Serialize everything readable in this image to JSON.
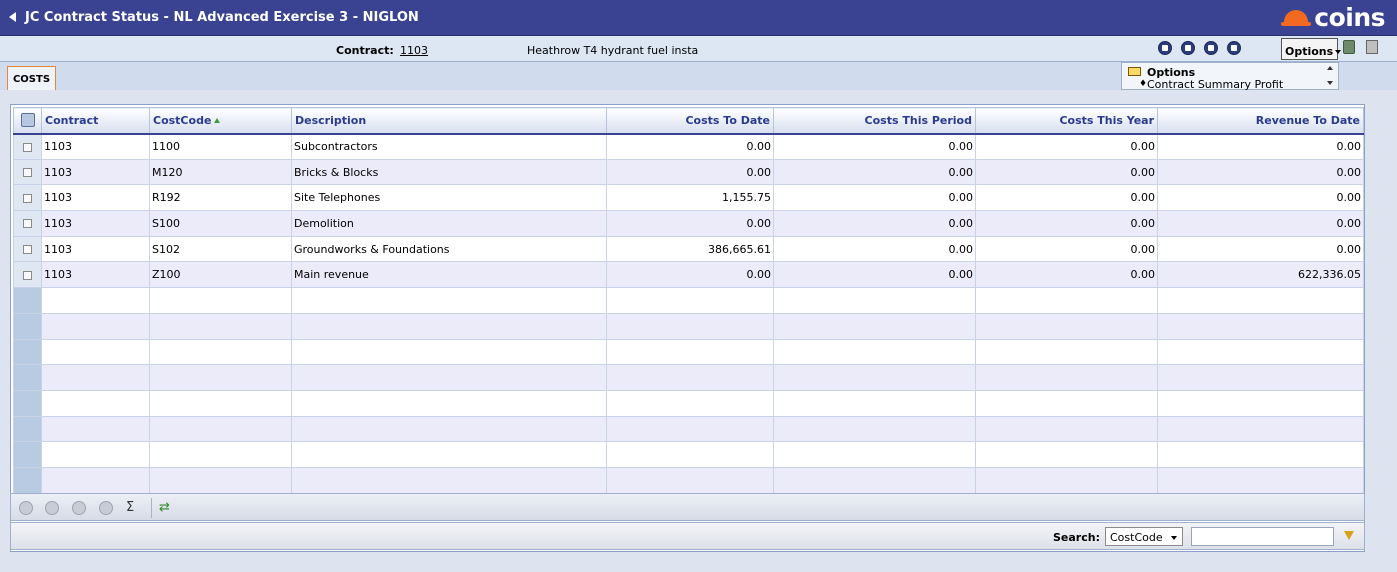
{
  "window": {
    "title": "JC Contract Status - NL Advanced Exercise 3 - NIGLON",
    "logo_text": "coins"
  },
  "header": {
    "contract_label": "Contract:",
    "contract_code": "1103",
    "contract_description": "Heathrow T4 hydrant fuel insta",
    "options_label": "Options"
  },
  "tabs": [
    {
      "label": "COSTS",
      "active": true
    }
  ],
  "options_panel": {
    "title": "Options",
    "item": "Contract Summary Profit"
  },
  "grid": {
    "columns": [
      "Contract",
      "CostCode",
      "Description",
      "Costs To Date",
      "Costs This Period",
      "Costs This Year",
      "Revenue To Date"
    ],
    "sorted_column": "CostCode",
    "rows": [
      {
        "contract": "1103",
        "costcode": "1100",
        "description": "Subcontractors",
        "costs_to_date": "0.00",
        "costs_this_period": "0.00",
        "costs_this_year": "0.00",
        "revenue_to_date": "0.00"
      },
      {
        "contract": "1103",
        "costcode": "M120",
        "description": "Bricks & Blocks",
        "costs_to_date": "0.00",
        "costs_this_period": "0.00",
        "costs_this_year": "0.00",
        "revenue_to_date": "0.00"
      },
      {
        "contract": "1103",
        "costcode": "R192",
        "description": "Site Telephones",
        "costs_to_date": "1,155.75",
        "costs_this_period": "0.00",
        "costs_this_year": "0.00",
        "revenue_to_date": "0.00"
      },
      {
        "contract": "1103",
        "costcode": "S100",
        "description": "Demolition",
        "costs_to_date": "0.00",
        "costs_this_period": "0.00",
        "costs_this_year": "0.00",
        "revenue_to_date": "0.00"
      },
      {
        "contract": "1103",
        "costcode": "S102",
        "description": "Groundworks & Foundations",
        "costs_to_date": "386,665.61",
        "costs_this_period": "0.00",
        "costs_this_year": "0.00",
        "revenue_to_date": "0.00"
      },
      {
        "contract": "1103",
        "costcode": "Z100",
        "description": "Main revenue",
        "costs_to_date": "0.00",
        "costs_this_period": "0.00",
        "costs_this_year": "0.00",
        "revenue_to_date": "622,336.05"
      }
    ]
  },
  "pager": {
    "sum_symbol": "Σ",
    "refresh_symbol": "⇄"
  },
  "search": {
    "label": "Search:",
    "field": "CostCode",
    "value": ""
  },
  "icons": {
    "back": "back-arrow-icon",
    "logo": "hardhat-icon",
    "nav_first": "first-record-icon",
    "nav_prev": "prev-record-icon",
    "nav_next": "next-record-icon",
    "nav_last": "last-record-icon",
    "clip": "clipboard-icon",
    "calc": "calculator-icon",
    "folder": "folder-open-icon",
    "filter": "filter-icon"
  },
  "colors": {
    "title_bar": "#3a4391",
    "header_text": "#2a3b8f",
    "tab_border": "#e0893a",
    "logo_orange": "#f26a21"
  }
}
